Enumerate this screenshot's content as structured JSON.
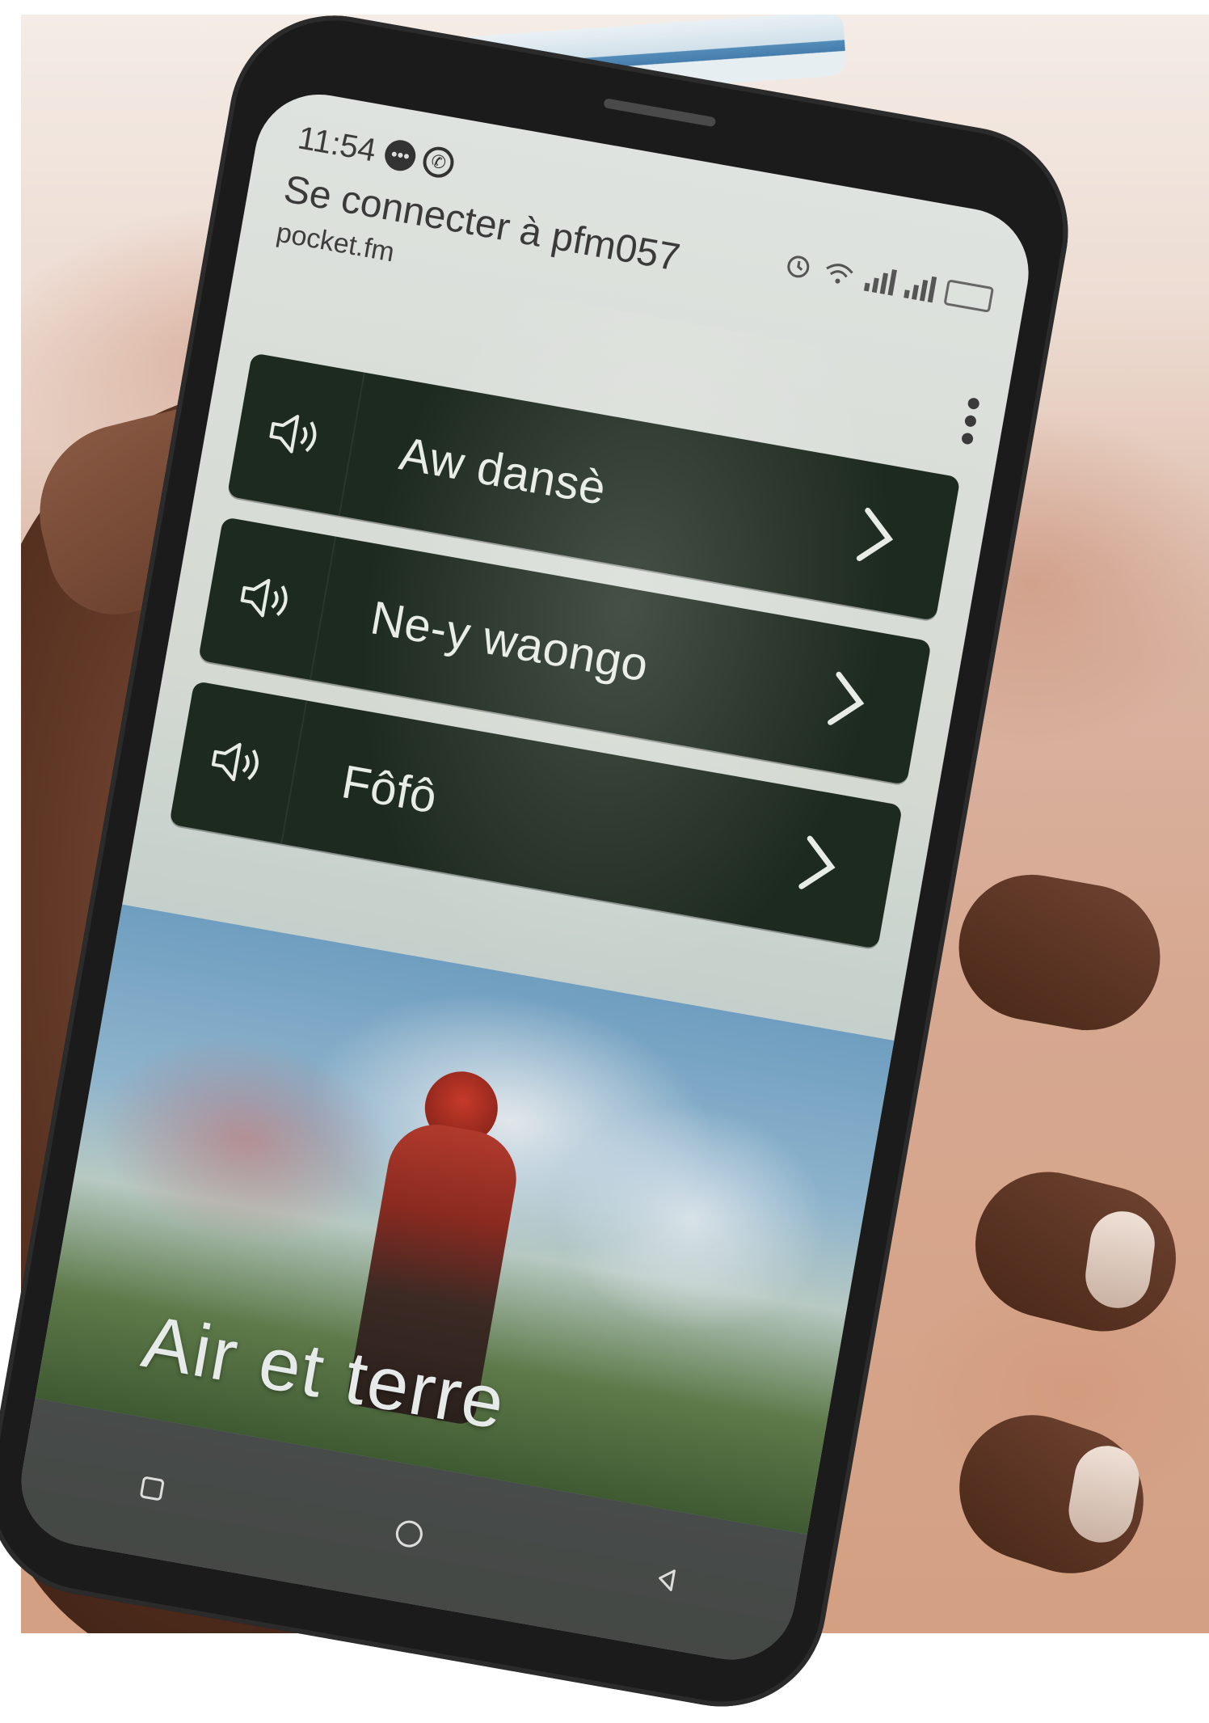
{
  "status_bar": {
    "time": "11:54"
  },
  "header": {
    "title": "Se connecter à pfm057",
    "subtitle": "pocket.fm"
  },
  "menu": {
    "items": [
      {
        "label": "Aw dansè",
        "icon": "speaker-icon",
        "action_icon": "chevron-right-icon"
      },
      {
        "label": "Ne-y waongo",
        "icon": "speaker-icon",
        "action_icon": "chevron-right-icon"
      },
      {
        "label": "Fôfô",
        "icon": "speaker-icon",
        "action_icon": "chevron-right-icon"
      }
    ]
  },
  "hero": {
    "title": "Air et terre"
  },
  "icons": {
    "status": [
      "message-icon",
      "whatsapp-icon",
      "alarm-icon",
      "wifi-icon",
      "signal-icon",
      "battery-icon"
    ],
    "overflow": "more-vertical-icon",
    "nav": [
      "recent-apps-icon",
      "home-icon",
      "back-icon"
    ]
  },
  "colors": {
    "menu_item_bg": "#1d2a1f",
    "menu_text": "#e7ece6",
    "header_text": "#3a3a3a"
  }
}
